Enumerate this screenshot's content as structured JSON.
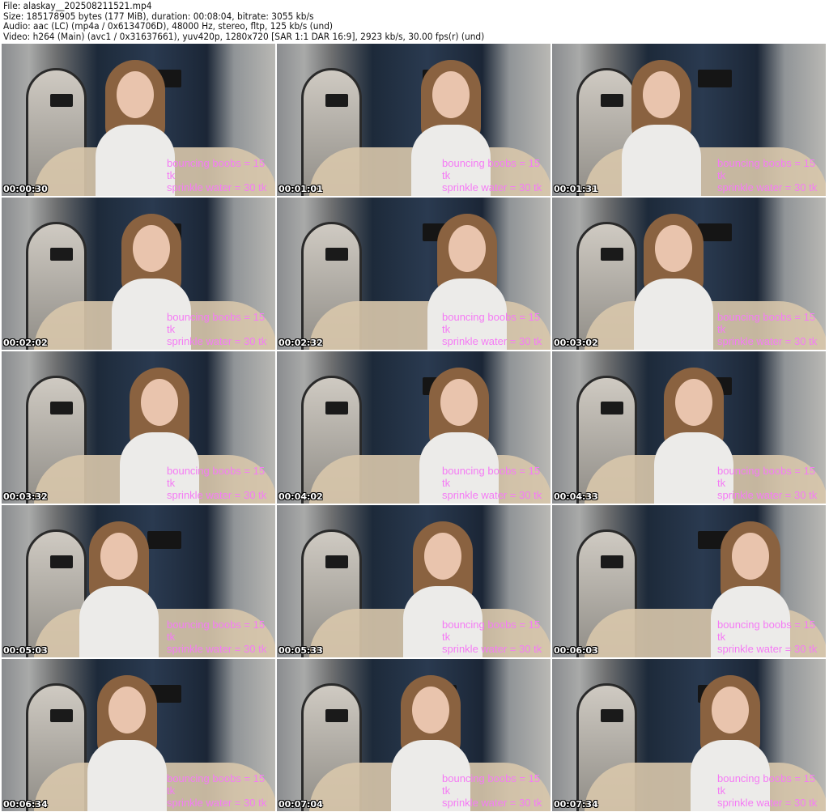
{
  "header": {
    "file": "File: alaskay__202508211521.mp4",
    "size": "Size: 185178905 bytes (177 MiB), duration: 00:08:04, bitrate: 3055 kb/s",
    "audio": "Audio: aac (LC) (mp4a / 0x6134706D), 48000 Hz, stereo, fltp, 125 kb/s (und)",
    "video": "Video: h264 (Main) (avc1 / 0x31637661), yuv420p, 1280x720 [SAR 1:1 DAR 16:9], 2923 kb/s, 30.00 fps(r) (und)"
  },
  "overlay": {
    "line1": "bouncing boobs = 15 tk",
    "line2": "sprinkle water = 30 tk"
  },
  "thumbnails": [
    {
      "timestamp": "00:00:30"
    },
    {
      "timestamp": "00:01:01"
    },
    {
      "timestamp": "00:01:31"
    },
    {
      "timestamp": "00:02:02"
    },
    {
      "timestamp": "00:02:32"
    },
    {
      "timestamp": "00:03:02"
    },
    {
      "timestamp": "00:03:32"
    },
    {
      "timestamp": "00:04:02"
    },
    {
      "timestamp": "00:04:33"
    },
    {
      "timestamp": "00:05:03"
    },
    {
      "timestamp": "00:05:33"
    },
    {
      "timestamp": "00:06:03"
    },
    {
      "timestamp": "00:06:34"
    },
    {
      "timestamp": "00:07:04"
    },
    {
      "timestamp": "00:07:34"
    }
  ]
}
